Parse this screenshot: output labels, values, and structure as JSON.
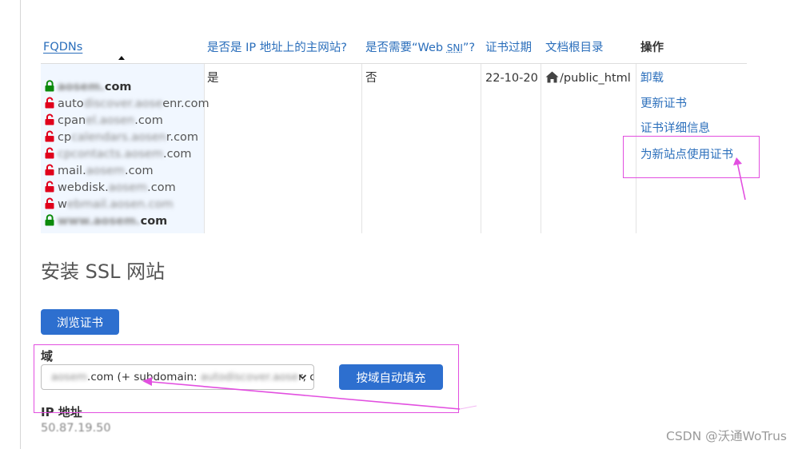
{
  "table": {
    "headers": {
      "fqdns": "FQDNs",
      "primary_site_pre": "是否是 IP 地址上的主网站?",
      "sni_pre": "是否需要“Web ",
      "sni_abbr": "SNI",
      "sni_post": "”?",
      "cert_expiry": "证书过期",
      "doc_root": "文档根目录",
      "actions": "操作"
    },
    "row": {
      "fqdn_list": [
        {
          "pre": "",
          "blur": "aosem.",
          "post": "com",
          "lock": "green",
          "primary": true
        },
        {
          "pre": "auto",
          "blur": "discover.aose",
          "post": "enr.com",
          "lock": "red",
          "primary": false
        },
        {
          "pre": "cpan",
          "blur": "el.aosen",
          "post": ".com",
          "lock": "red",
          "primary": false
        },
        {
          "pre": "cp",
          "blur": "calendars.aosen",
          "post": "r.com",
          "lock": "red",
          "primary": false
        },
        {
          "pre": "",
          "blur": "cpcontacts.aosem",
          "post": ".com",
          "lock": "red",
          "primary": false
        },
        {
          "pre": "mail.",
          "blur": "aosem",
          "post": ".com",
          "lock": "red",
          "primary": false
        },
        {
          "pre": "webdisk.",
          "blur": "aosem",
          "post": ".com",
          "lock": "red",
          "primary": false
        },
        {
          "pre": "w",
          "blur": "ebmail.aosen.com",
          "post": "",
          "lock": "red",
          "primary": false
        },
        {
          "pre": "",
          "blur": "www.aosem.",
          "post": "com",
          "lock": "green",
          "primary": true
        }
      ],
      "primary_site": "是",
      "sni_required": "否",
      "cert_expiry": "22-10-20",
      "doc_root": "/public_html",
      "actions": [
        "卸载",
        "更新证书",
        "证书详细信息",
        "为新站点使用证书"
      ]
    }
  },
  "install": {
    "title": "安装 SSL 网站",
    "browse_button": "浏览证书",
    "domain_label": "域",
    "domain_select": {
      "value_blur": "aosem",
      "value_text": ".com   (+ subdomain: ",
      "value_blur2": "autodiscover.aose",
      "value_tail": "r, cp"
    },
    "autofill_button": "按域自动填充",
    "ip_label": "IP 地址",
    "ip_value": "50.87.19.50"
  },
  "watermark": "CSDN @沃通WoTrus",
  "colors": {
    "link": "#2a6ebb",
    "button": "#2d6fcf",
    "annotation": "#e24fe0",
    "lock_secure": "#0b8a0b",
    "lock_insecure": "#e0001b",
    "fqdn_bg": "#f1f7ff"
  },
  "icons": {
    "secure": "lock-closed-green-icon",
    "insecure": "lock-open-red-icon",
    "home": "home-icon",
    "sort": "sort-ascending-icon",
    "dropdown": "chevron-down-icon"
  }
}
